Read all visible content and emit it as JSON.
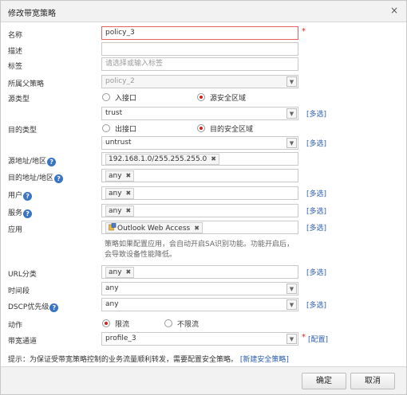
{
  "dialog": {
    "title": "修改带宽策略",
    "close_glyph": "×"
  },
  "fields": {
    "name": {
      "label": "名称",
      "value": "policy_3",
      "required": "*"
    },
    "desc": {
      "label": "描述",
      "value": ""
    },
    "tag": {
      "label": "标签",
      "placeholder": "请选择或输入标签"
    },
    "parent": {
      "label": "所属父策略",
      "value": "policy_2"
    },
    "src_type": {
      "label": "源类型",
      "option1": "入接口",
      "option2": "源安全区域",
      "selected": "源安全区域",
      "select_value": "trust",
      "link": "[多选]"
    },
    "dst_type": {
      "label": "目的类型",
      "option1": "出接口",
      "option2": "目的安全区域",
      "selected": "目的安全区域",
      "select_value": "untrust",
      "link": "[多选]"
    },
    "src_addr": {
      "label": "源地址/地区",
      "tag": "192.168.1.0/255.255.255.0"
    },
    "dst_addr": {
      "label": "目的地址/地区",
      "tag": "any"
    },
    "user": {
      "label": "用户",
      "tag": "any",
      "link": "[多选]"
    },
    "service": {
      "label": "服务",
      "tag": "any",
      "link": "[多选]"
    },
    "app": {
      "label": "应用",
      "tag": "Outlook Web Access",
      "link": "[多选]",
      "hint": "策略如果配置应用，会自动开启SA识别功能。功能开启后，会导致设备性能降低。"
    },
    "url": {
      "label": "URL分类",
      "tag": "any",
      "link": "[多选]"
    },
    "time": {
      "label": "时间段",
      "value": "any"
    },
    "dscp": {
      "label": "DSCP优先级",
      "value": "any",
      "link": "[多选]"
    },
    "action": {
      "label": "动作",
      "option1": "限流",
      "option2": "不限流",
      "selected": "限流"
    },
    "channel": {
      "label": "带宽通道",
      "value": "profile_3",
      "required": "*",
      "link": "[配置]"
    }
  },
  "footer": {
    "note": "提示：为保证受带宽策略控制的业务流量顺利转发，需要配置安全策略。",
    "note_link": "[新建安全策略]",
    "ok_label": "确定",
    "cancel_label": "取消"
  },
  "icons": {
    "help": "question-circle-icon",
    "dropdown": "chevron-down-icon",
    "tag_remove": "close-icon",
    "app": "app-icon"
  },
  "colors": {
    "accent_link": "#2a5db0",
    "radio_selected": "#d02020",
    "help_icon": "#3a74c5",
    "required": "#e02020"
  }
}
